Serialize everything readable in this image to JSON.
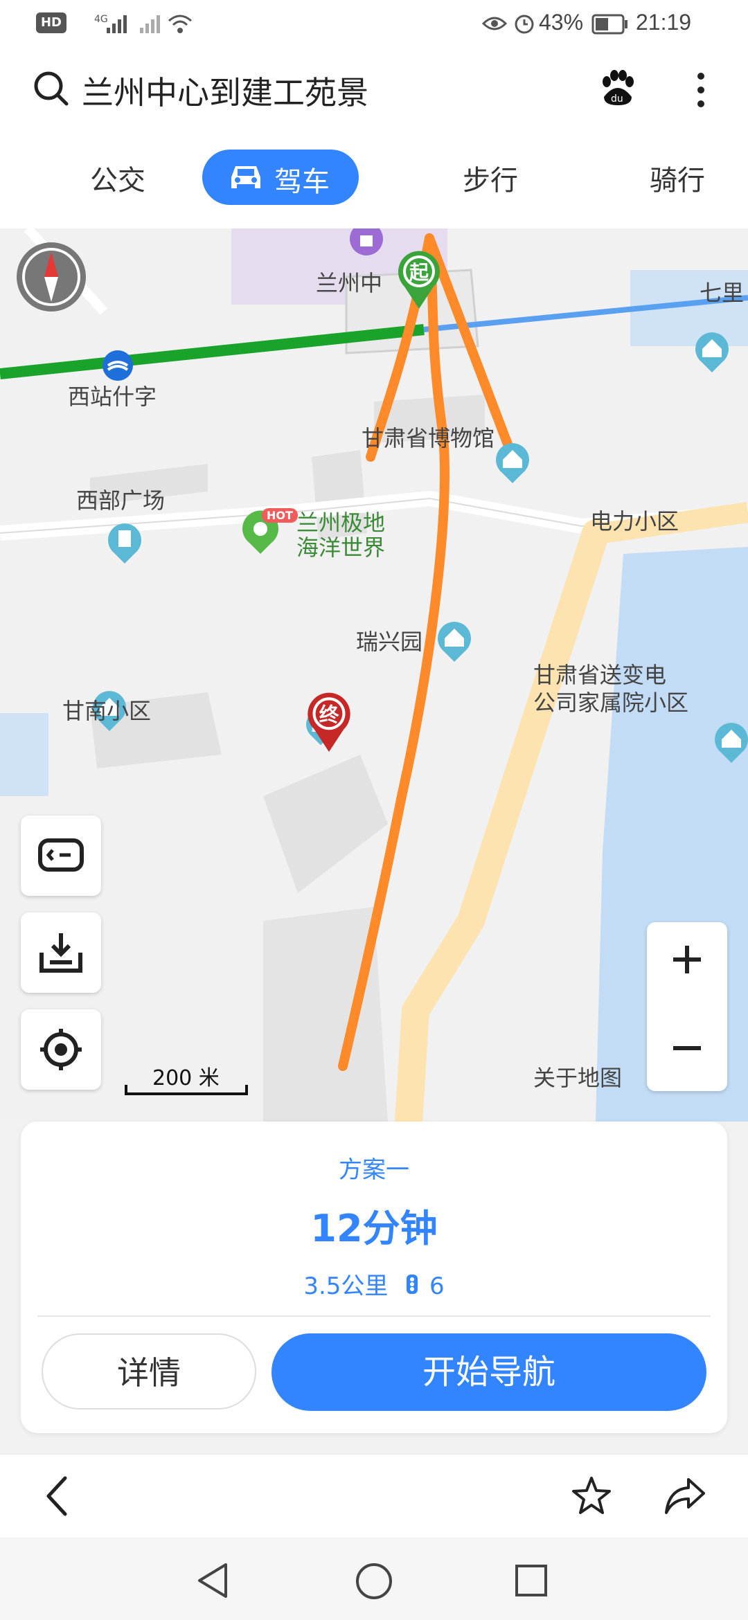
{
  "status_bar": {
    "network_left": "HD",
    "signal_4g": "4G",
    "battery": "43%",
    "time": "21:19"
  },
  "header": {
    "title": "兰州中心到建工苑景",
    "icons": [
      "search-icon",
      "baidu-paw-icon",
      "more-vertical-icon"
    ]
  },
  "tabs": [
    {
      "label": "公交",
      "active": false
    },
    {
      "label": "驾车",
      "active": true,
      "icon": "car-icon"
    },
    {
      "label": "步行",
      "active": false
    },
    {
      "label": "骑行",
      "active": false
    }
  ],
  "map": {
    "labels": {
      "lanzhou_center": "兰州中",
      "qili": "七里",
      "xizhan": "西站什字",
      "museum": "甘肃省博物馆",
      "xibu": "西部广场",
      "dianli": "电力小区",
      "gansu_company": "甘肃省送变电",
      "gansu_company_2": "公司家属院小区",
      "ocean": "兰州极地",
      "ocean_2": "海洋世界",
      "hot_badge": "HOT",
      "ruixing": "瑞兴园",
      "xinan": "甘南小区",
      "about_map": "关于地图",
      "start_marker": "起",
      "end_marker": "终"
    },
    "scale": "200 米",
    "colors": {
      "route_green": "#1aa32a",
      "route_blue": "#5aa0f0",
      "annotation_orange": "#ff8a2a",
      "road_yellow": "#fde3b0",
      "water": "#c2dcf5"
    }
  },
  "route_card": {
    "plan_name": "方案一",
    "duration": "12分钟",
    "distance": "3.5公里",
    "traffic_lights": "6",
    "details_button": "详情",
    "start_nav_button": "开始导航"
  },
  "toolbar": {
    "icons": [
      "back-arrow-icon",
      "star-icon",
      "share-icon"
    ]
  },
  "system_nav": {
    "icons": [
      "nav-back-icon",
      "nav-home-icon",
      "nav-recents-icon"
    ]
  }
}
